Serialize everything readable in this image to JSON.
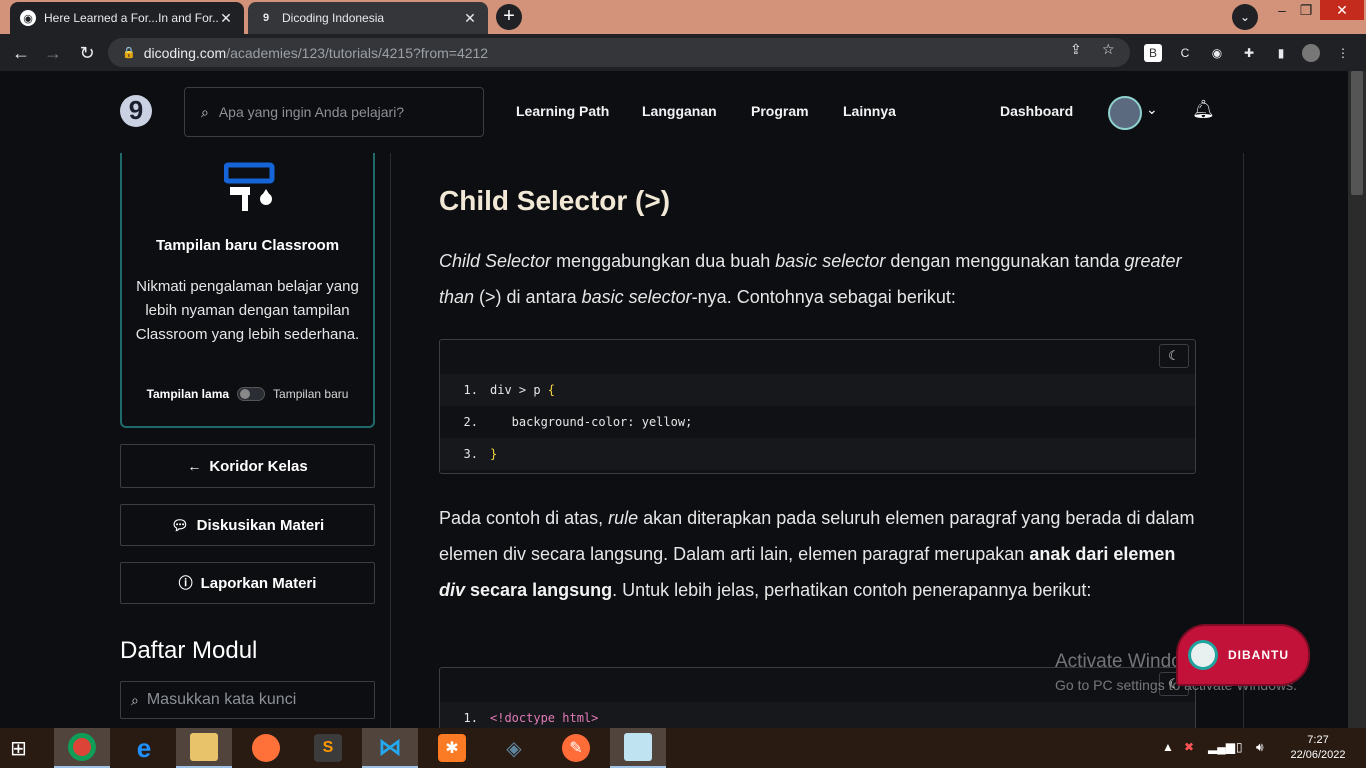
{
  "browser": {
    "tabs": [
      {
        "title": "Here Learned a For...In and For...o",
        "active": true
      },
      {
        "title": "Dicoding Indonesia",
        "active": false
      }
    ],
    "new_tab": "+",
    "url_host": "dicoding.com",
    "url_path": "/academies/123/tutorials/4215?from=4212"
  },
  "header": {
    "logo": "9",
    "search_placeholder": "Apa yang ingin Anda pelajari?",
    "nav": [
      "Learning Path",
      "Langganan",
      "Program",
      "Lainnya"
    ],
    "dashboard": "Dashboard"
  },
  "sidebar": {
    "promo_title": "Tampilan baru Classroom",
    "promo_desc": "Nikmati pengalaman belajar yang lebih nyaman dengan tampilan Classroom yang lebih sederhana.",
    "toggle_old": "Tampilan lama",
    "toggle_new": "Tampilan baru",
    "buttons": [
      "Koridor Kelas",
      "Diskusikan Materi",
      "Laporkan Materi"
    ],
    "module_heading": "Daftar Modul",
    "module_search_placeholder": "Masukkan kata kunci"
  },
  "content": {
    "heading": "Child Selector (>)",
    "p1": {
      "t1": "Child Selector",
      "t2": " menggabungkan dua buah ",
      "t3": "basic selector",
      "t4": " dengan menggunakan tanda ",
      "t5": "greater than",
      "t6": " (>) di antara ",
      "t7": "basic selector",
      "t8": "-nya. Contohnya sebagai berikut:"
    },
    "code1": [
      {
        "n": "1.",
        "a": "div > p ",
        "b": "{"
      },
      {
        "n": "2.",
        "a": "   background-color: yellow;",
        "b": ""
      },
      {
        "n": "3.",
        "a": "",
        "b": "}"
      }
    ],
    "p2": {
      "t1": "Pada contoh di atas, ",
      "t2": "rule",
      "t3": " akan diterapkan pada seluruh elemen paragraf yang berada di dalam elemen div secara langsung. Dalam arti lain, elemen paragraf merupakan ",
      "t4": "anak dari elemen ",
      "t5": "div",
      "t6": " secara langsung",
      "t7": ". Untuk lebih jelas, perhatikan contoh penerapannya berikut:"
    },
    "code2": [
      {
        "n": "1.",
        "a": "<!doctype html>"
      }
    ]
  },
  "overlay": {
    "watermark_title": "Activate Windows",
    "watermark_sub": "Go to PC settings to activate Windows.",
    "help_badge": "DIBANTU"
  },
  "taskbar": {
    "time": "7:27",
    "date": "22/06/2022"
  },
  "colors": {
    "accent_teal": "#1f6b6a",
    "heading": "#f1e8d6",
    "badge": "#c2123a"
  }
}
